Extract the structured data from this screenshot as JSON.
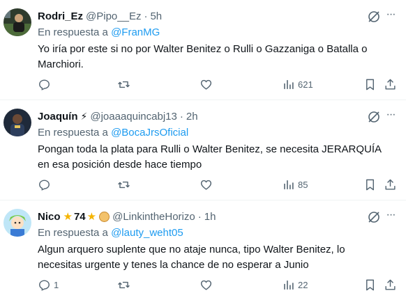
{
  "colors": {
    "link": "#1d9bf0",
    "muted": "#536471",
    "text": "#0f1419",
    "divider": "#eff3f4"
  },
  "tweets": [
    {
      "name": "Rodri_Ez",
      "handle": "@Pipo__Ez",
      "dot": "·",
      "time": "5h",
      "reply_prefix": "En respuesta a",
      "reply_to": "@FranMG",
      "text": "Yo iría por este si no por Walter Benitez o Rulli o Gazzaniga o Batalla o Marchiori.",
      "replies": "",
      "retweets": "",
      "likes": "",
      "views": "621"
    },
    {
      "name": "Joaquín",
      "badge_icon": "lightning-icon",
      "badge": "⚡",
      "handle": "@joaaaquincabj13",
      "dot": "·",
      "time": "2h",
      "reply_prefix": "En respuesta a",
      "reply_to": "@BocaJrsOficial",
      "text": "Pongan toda la plata para Rulli o Walter Benitez, se necesita JERARQUÍA en esa posición desde hace tiempo",
      "replies": "",
      "retweets": "",
      "likes": "",
      "views": "85"
    },
    {
      "name": "Nico",
      "star": "★",
      "name_number": "74",
      "handle": "@LinkintheHorizo",
      "dot": "·",
      "time": "1h",
      "reply_prefix": "En respuesta a",
      "reply_to": "@lauty_weht05",
      "text": "Algun arquero suplente que no ataje nunca, tipo Walter Benitez, lo necesitas urgente y tenes la chance de no esperar a Junio",
      "replies": "1",
      "retweets": "",
      "likes": "",
      "views": "22"
    }
  ],
  "icons": {
    "reply": "reply-icon",
    "retweet": "retweet-icon",
    "like": "heart-icon",
    "views": "views-chart-icon",
    "bookmark": "bookmark-icon",
    "share": "share-icon",
    "grok": "grok-icon",
    "more": "more-dots-icon"
  },
  "more_glyph": "···"
}
